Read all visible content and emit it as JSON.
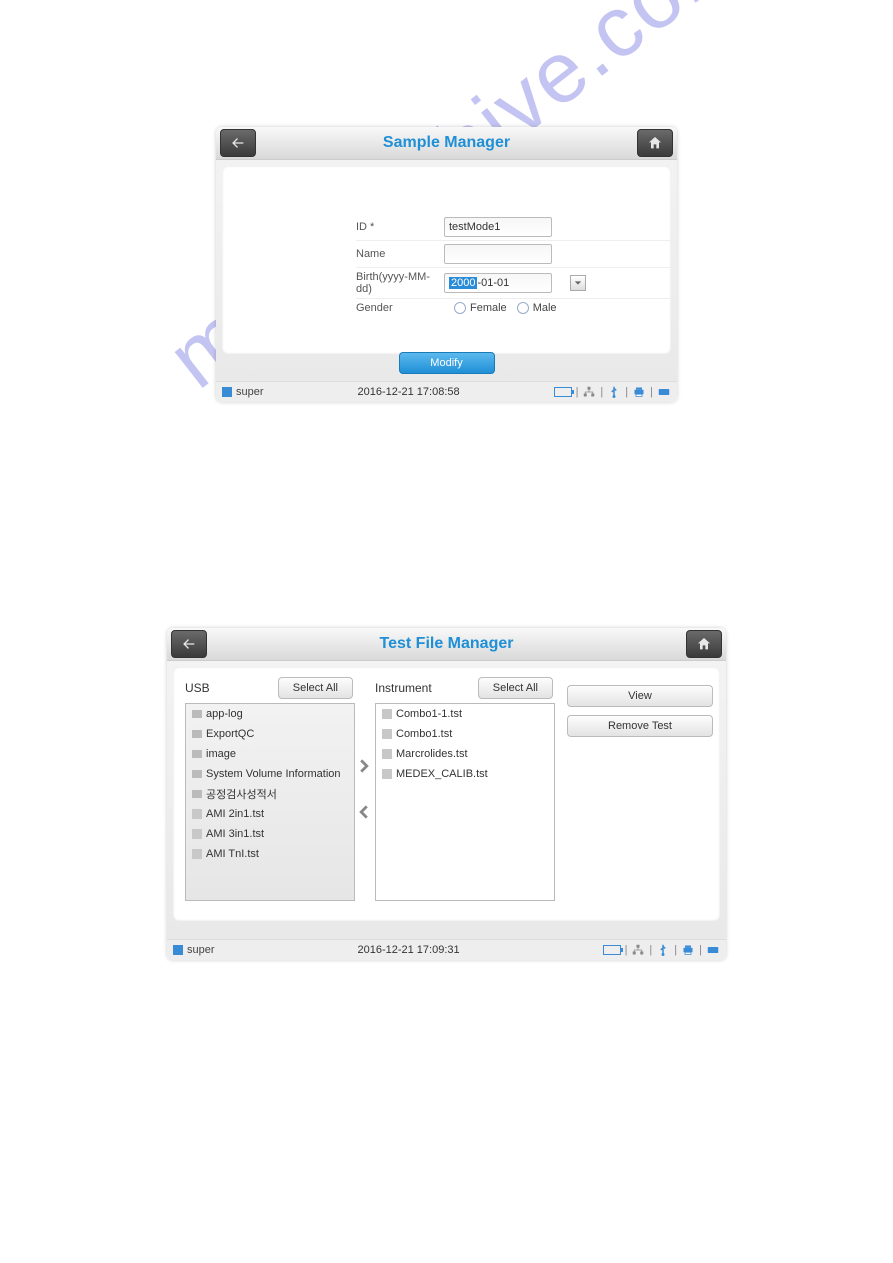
{
  "watermark": "manualshive.com",
  "window1": {
    "title": "Sample Manager",
    "form": {
      "id_label": "ID *",
      "id_value": "testMode1",
      "name_label": "Name",
      "name_value": "",
      "birth_label": "Birth(yyyy-MM-dd)",
      "birth_year_sel": "2000",
      "birth_rest": "-01-01",
      "gender_label": "Gender",
      "gender_female": "Female",
      "gender_male": "Male"
    },
    "modify": "Modify",
    "status": {
      "user": "super",
      "timestamp": "2016-12-21 17:08:58"
    }
  },
  "window2": {
    "title": "Test File Manager",
    "usb_label": "USB",
    "instrument_label": "Instrument",
    "select_all": "Select All",
    "view": "View",
    "remove_test": "Remove Test",
    "usb_items": [
      "app-log",
      "ExportQC",
      "image",
      "System Volume Information",
      "공정검사성적서",
      "AMI 2in1.tst",
      "AMI 3in1.tst",
      "AMI TnI.tst"
    ],
    "instrument_items": [
      "Combo1-1.tst",
      "Combo1.tst",
      "Marcrolides.tst",
      "MEDEX_CALIB.tst"
    ],
    "status": {
      "user": "super",
      "timestamp": "2016-12-21 17:09:31"
    }
  }
}
